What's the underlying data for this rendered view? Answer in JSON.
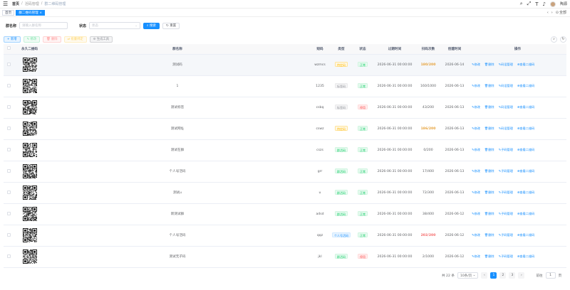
{
  "nav": {
    "breadcrumb": [
      "首页",
      "活码管理",
      "群二维码管理"
    ],
    "username": "陶源"
  },
  "tags": {
    "items": [
      {
        "label": "首页"
      },
      {
        "label": "群二维码管理"
      }
    ],
    "close_all": "全部",
    "close_icon": "×"
  },
  "search": {
    "name_label": "群名称",
    "name_placeholder": "请输入群名称",
    "status_label": "状态",
    "status_placeholder": "状态",
    "search_btn": "搜索",
    "reset_btn": "重置"
  },
  "toolbar": {
    "add": "新增",
    "edit": "修改",
    "delete": "删除",
    "bind": "批量绑定",
    "gen": "生成工具"
  },
  "table": {
    "headers": [
      "永久二维码",
      "群名称",
      "短码",
      "类型",
      "状态",
      "过期时间",
      "扫码次数",
      "创建时间",
      "操作"
    ],
    "ops_labels": [
      "修改",
      "删除",
      "修改",
      "查看二维码"
    ],
    "rows": [
      {
        "name": "测试码",
        "code": "wzmcs",
        "type": "特定码",
        "type_style": "t-warn",
        "status": "正常",
        "status_style": "t-succ",
        "expire": "2026-06-31 00:00:00",
        "scan": "180/200",
        "scan_style": "cnt-warn",
        "created": "2026-06-14",
        "op3": "码设管理"
      },
      {
        "name": "1",
        "code": "1235",
        "type": "标签码",
        "type_style": "t-info",
        "status": "正常",
        "status_style": "t-succ",
        "expire": "2026-06-31 00:00:00",
        "scan": "160/1000",
        "scan_style": "",
        "created": "2026-06-13",
        "op3": "码设管理"
      },
      {
        "name": "测试标签",
        "code": "csbq",
        "type": "标签码",
        "type_style": "t-info",
        "status": "停用",
        "status_style": "t-dang",
        "expire": "2026-06-31 00:00:00",
        "scan": "43/200",
        "scan_style": "",
        "created": "2026-06-13",
        "op3": "码设管理"
      },
      {
        "name": "测试网址",
        "code": "cswz",
        "type": "特定码",
        "type_style": "t-warn",
        "status": "正常",
        "status_style": "t-succ",
        "expire": "2026-06-31 00:00:00",
        "scan": "186/200",
        "scan_style": "cnt-warn",
        "created": "2026-06-13",
        "op3": "码设管理"
      },
      {
        "name": "测试在群",
        "code": "cszs",
        "type": "群活码",
        "type_style": "t-succ",
        "status": "正常",
        "status_style": "t-succ",
        "expire": "2026-06-31 00:00:00",
        "scan": "0/200",
        "scan_style": "",
        "created": "2026-06-13",
        "op3": "子码管理"
      },
      {
        "name": "个人号活码",
        "code": "grr",
        "type": "群活码",
        "type_style": "t-succ",
        "status": "正常",
        "status_style": "t-succ",
        "expire": "2026-06-31 00:00:00",
        "scan": "17/400",
        "scan_style": "",
        "created": "2026-06-13",
        "op3": "子码管理"
      },
      {
        "name": "测试u",
        "code": "u",
        "type": "群活码",
        "type_style": "t-succ",
        "status": "正常",
        "status_style": "t-succ",
        "expire": "2026-06-31 00:00:00",
        "scan": "72/300",
        "scan_style": "",
        "created": "2026-06-13",
        "op3": "子码管理"
      },
      {
        "name": "新测试群",
        "code": "adsd",
        "type": "群活码",
        "type_style": "t-succ",
        "status": "正常",
        "status_style": "t-succ",
        "expire": "2026-06-31 00:00:00",
        "scan": "38/400",
        "scan_style": "",
        "created": "2026-06-12",
        "op3": "子码管理"
      },
      {
        "name": "个人号活码",
        "code": "qqz",
        "type": "个人号活码",
        "type_style": "t-prim",
        "status": "正常",
        "status_style": "t-succ",
        "expire": "2026-06-31 00:00:00",
        "scan": "202/200",
        "scan_style": "cnt-dang",
        "created": "2026-06-12",
        "op3": "子码管理"
      },
      {
        "name": "测试无子码",
        "code": "jkl",
        "type": "群活码",
        "type_style": "t-succ",
        "status": "停用",
        "status_style": "t-dang",
        "expire": "2026-06-31 00:00:00",
        "scan": "2/1000",
        "scan_style": "",
        "created": "2026-06-12",
        "op3": "子码管理"
      }
    ]
  },
  "pager": {
    "total": "共 22 条",
    "size": "10条/页",
    "pages": [
      "1",
      "2",
      "3"
    ],
    "goto_label": "前往",
    "goto_value": "1",
    "goto_suffix": "页"
  }
}
